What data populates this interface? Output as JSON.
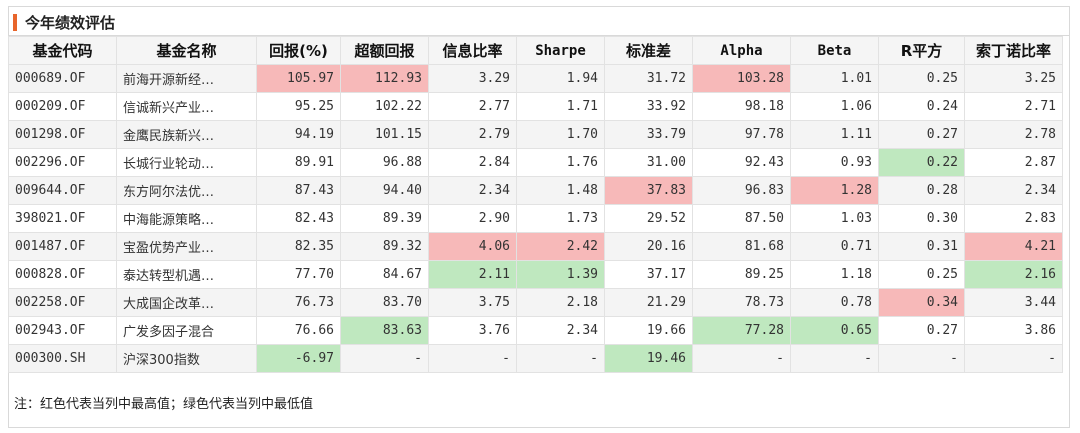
{
  "title": "今年绩效评估",
  "note": "注：红色代表当列中最高值；绿色代表当列中最低值",
  "colors": {
    "accent": "#e8652b",
    "highest": "#f7b9b9",
    "lowest": "#bfe8bf"
  },
  "headers": [
    "基金代码",
    "基金名称",
    "回报(%)",
    "超额回报",
    "信息比率",
    "Sharpe",
    "标准差",
    "Alpha",
    "Beta",
    "R平方",
    "索丁诺比率"
  ],
  "rows": [
    {
      "code": "000689.OF",
      "name": "前海开源新经…",
      "values": [
        "105.97",
        "112.93",
        "3.29",
        "1.94",
        "31.72",
        "103.28",
        "1.01",
        "0.25",
        "3.25"
      ],
      "marks": [
        "hi",
        "hi",
        "",
        "",
        "",
        "hi",
        "",
        "",
        ""
      ]
    },
    {
      "code": "000209.OF",
      "name": "信诚新兴产业…",
      "values": [
        "95.25",
        "102.22",
        "2.77",
        "1.71",
        "33.92",
        "98.18",
        "1.06",
        "0.24",
        "2.71"
      ],
      "marks": [
        "",
        "",
        "",
        "",
        "",
        "",
        "",
        "",
        ""
      ]
    },
    {
      "code": "001298.OF",
      "name": "金鹰民族新兴…",
      "values": [
        "94.19",
        "101.15",
        "2.79",
        "1.70",
        "33.79",
        "97.78",
        "1.11",
        "0.27",
        "2.78"
      ],
      "marks": [
        "",
        "",
        "",
        "",
        "",
        "",
        "",
        "",
        ""
      ]
    },
    {
      "code": "002296.OF",
      "name": "长城行业轮动…",
      "values": [
        "89.91",
        "96.88",
        "2.84",
        "1.76",
        "31.00",
        "92.43",
        "0.93",
        "0.22",
        "2.87"
      ],
      "marks": [
        "",
        "",
        "",
        "",
        "",
        "",
        "",
        "lo",
        ""
      ]
    },
    {
      "code": "009644.OF",
      "name": "东方阿尔法优…",
      "values": [
        "87.43",
        "94.40",
        "2.34",
        "1.48",
        "37.83",
        "96.83",
        "1.28",
        "0.28",
        "2.34"
      ],
      "marks": [
        "",
        "",
        "",
        "",
        "hi",
        "",
        "hi",
        "",
        ""
      ]
    },
    {
      "code": "398021.OF",
      "name": "中海能源策略…",
      "values": [
        "82.43",
        "89.39",
        "2.90",
        "1.73",
        "29.52",
        "87.50",
        "1.03",
        "0.30",
        "2.83"
      ],
      "marks": [
        "",
        "",
        "",
        "",
        "",
        "",
        "",
        "",
        ""
      ]
    },
    {
      "code": "001487.OF",
      "name": "宝盈优势产业…",
      "values": [
        "82.35",
        "89.32",
        "4.06",
        "2.42",
        "20.16",
        "81.68",
        "0.71",
        "0.31",
        "4.21"
      ],
      "marks": [
        "",
        "",
        "hi",
        "hi",
        "",
        "",
        "",
        "",
        "hi"
      ]
    },
    {
      "code": "000828.OF",
      "name": "泰达转型机遇…",
      "values": [
        "77.70",
        "84.67",
        "2.11",
        "1.39",
        "37.17",
        "89.25",
        "1.18",
        "0.25",
        "2.16"
      ],
      "marks": [
        "",
        "",
        "lo",
        "lo",
        "",
        "",
        "",
        "",
        "lo"
      ]
    },
    {
      "code": "002258.OF",
      "name": "大成国企改革…",
      "values": [
        "76.73",
        "83.70",
        "3.75",
        "2.18",
        "21.29",
        "78.73",
        "0.78",
        "0.34",
        "3.44"
      ],
      "marks": [
        "",
        "",
        "",
        "",
        "",
        "",
        "",
        "hi",
        ""
      ]
    },
    {
      "code": "002943.OF",
      "name": "广发多因子混合",
      "values": [
        "76.66",
        "83.63",
        "3.76",
        "2.34",
        "19.66",
        "77.28",
        "0.65",
        "0.27",
        "3.86"
      ],
      "marks": [
        "",
        "lo",
        "",
        "",
        "",
        "lo",
        "lo",
        "",
        ""
      ]
    },
    {
      "code": "000300.SH",
      "name": "沪深300指数",
      "values": [
        "-6.97",
        "-",
        "-",
        "-",
        "19.46",
        "-",
        "-",
        "-",
        "-"
      ],
      "marks": [
        "lo",
        "",
        "",
        "",
        "lo",
        "",
        "",
        "",
        ""
      ]
    }
  ]
}
